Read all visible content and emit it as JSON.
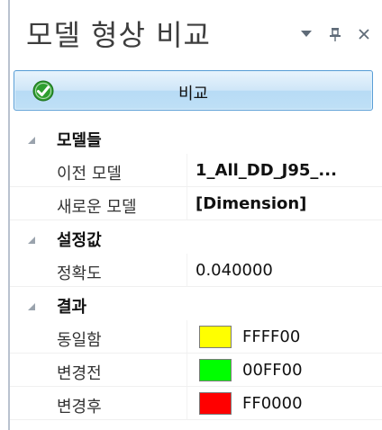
{
  "panel": {
    "title": "모델 형상 비교",
    "icons": [
      "dropdown-icon",
      "pin-icon",
      "close-icon"
    ]
  },
  "compare_button": {
    "label": "비교",
    "icon": "check-circle-icon",
    "icon_color": "#2e9e2e"
  },
  "categories": [
    {
      "label": "모델들",
      "properties": [
        {
          "name": "이전 모델",
          "value": "1_All_DD_J95_..."
        },
        {
          "name": "새로운 모델",
          "value": "[Dimension]"
        }
      ]
    },
    {
      "label": "설정값",
      "properties": [
        {
          "name": "정확도",
          "value": "0.040000"
        }
      ]
    },
    {
      "label": "결과",
      "properties": [
        {
          "name": "동일함",
          "value": "FFFF00",
          "color": "#FFFF00"
        },
        {
          "name": "변경전",
          "value": "00FF00",
          "color": "#00FF00"
        },
        {
          "name": "변경후",
          "value": "FF0000",
          "color": "#FF0000"
        }
      ]
    }
  ]
}
